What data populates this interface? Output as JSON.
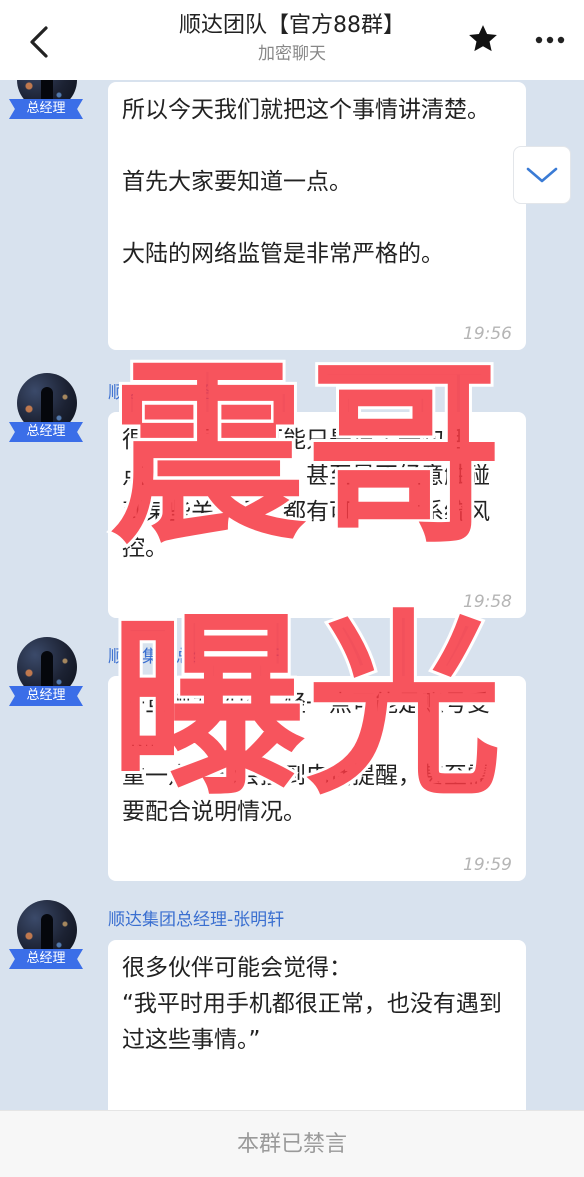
{
  "header": {
    "title": "顺达团队【官方88群】",
    "subtitle": "加密聊天",
    "back_icon": "chevron-left-icon",
    "star_icon": "star-icon",
    "more_icon": "more-dots-icon"
  },
  "messages": [
    {
      "sender": "",
      "badge": "总经理",
      "text": "所以今天我们就把这个事情讲清楚。\n\n首先大家要知道一点。\n\n大陆的网络监管是非常严格的。",
      "time": "19:56"
    },
    {
      "sender": "顺达集团总经理-张明轩",
      "badge": "总经理",
      "text": "很多时候，你可能只是说了一句话、点开了一个内容，甚至是不经意触碰到某些关键词，都有可能触发系统风控。",
      "time": "19:58"
    },
    {
      "sender": "顺达集团总经理-张明轩",
      "badge": "总经理",
      "text": "一旦触发风控，轻一点可能是账号受限。\n重一点可能会接到电话提醒，甚至需要配合说明情况。",
      "time": "19:59"
    },
    {
      "sender": "顺达集团总经理-张明轩",
      "badge": "总经理",
      "text": "很多伙伴可能会觉得：\n“我平时用手机都很正常，也没有遇到过这些事情。”",
      "time": ""
    }
  ],
  "scroll_down_icon": "chevron-down-icon",
  "watermark": {
    "line1": "震哥",
    "line2": "曝光"
  },
  "footer": {
    "muted_text": "本群已禁言"
  },
  "colors": {
    "chat_background": "#d8e2ee",
    "badge": "#3b6ee8",
    "sender_name": "#3a6fd0",
    "watermark": "#f63842"
  }
}
